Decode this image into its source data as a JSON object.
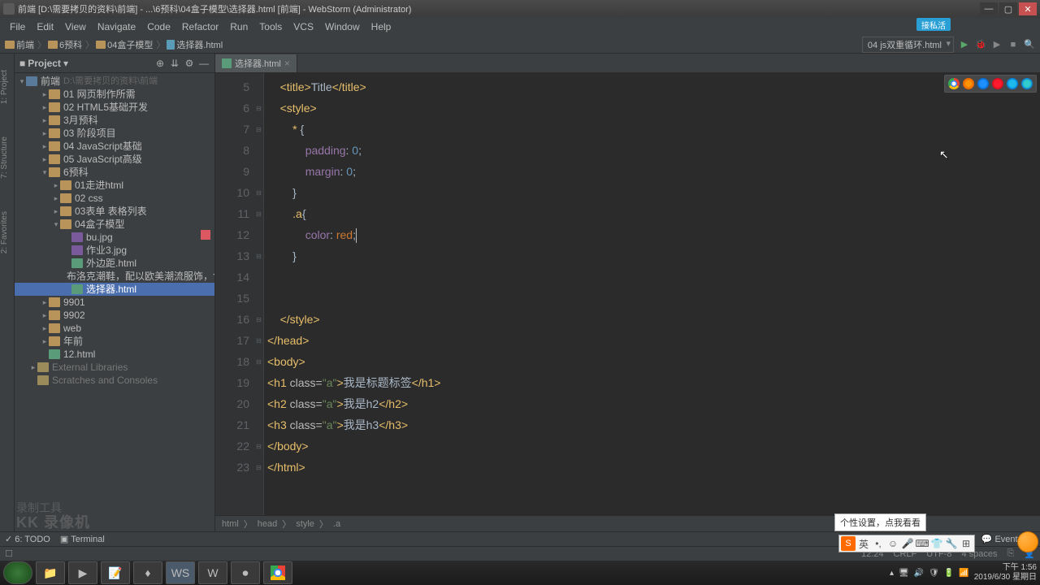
{
  "title": "前端 [D:\\需要拷贝的资料\\前端] - ...\\6预科\\04盒子模型\\选择器.html [前端] - WebStorm (Administrator)",
  "menu": [
    "File",
    "Edit",
    "View",
    "Navigate",
    "Code",
    "Refactor",
    "Run",
    "Tools",
    "VCS",
    "Window",
    "Help"
  ],
  "cloud_label": "接私活",
  "nav": {
    "crumbs": [
      "前端",
      "6预科",
      "04盒子模型",
      "选择器.html"
    ],
    "run_config": "04 js双重循环.html"
  },
  "project": {
    "title": "Project",
    "root": {
      "label": "前端",
      "path": "D:\\需要拷贝的资料\\前端"
    },
    "items": [
      {
        "label": "01 网页制作所需",
        "indent": 2,
        "arrow": "▸",
        "ico": "ico-folder"
      },
      {
        "label": "02 HTML5基础开发",
        "indent": 2,
        "arrow": "▸",
        "ico": "ico-folder"
      },
      {
        "label": "3月预科",
        "indent": 2,
        "arrow": "▸",
        "ico": "ico-folder"
      },
      {
        "label": "03 阶段项目",
        "indent": 2,
        "arrow": "▸",
        "ico": "ico-folder"
      },
      {
        "label": "04 JavaScript基础",
        "indent": 2,
        "arrow": "▸",
        "ico": "ico-folder"
      },
      {
        "label": "05 JavaScript高级",
        "indent": 2,
        "arrow": "▸",
        "ico": "ico-folder"
      },
      {
        "label": "6预科",
        "indent": 2,
        "arrow": "▾",
        "ico": "ico-folder"
      },
      {
        "label": "01走进html",
        "indent": 3,
        "arrow": "▸",
        "ico": "ico-folder"
      },
      {
        "label": "02 css",
        "indent": 3,
        "arrow": "▸",
        "ico": "ico-folder"
      },
      {
        "label": "03表单 表格列表",
        "indent": 3,
        "arrow": "▸",
        "ico": "ico-folder"
      },
      {
        "label": "04盒子模型",
        "indent": 3,
        "arrow": "▾",
        "ico": "ico-folder"
      },
      {
        "label": "bu.jpg",
        "indent": 4,
        "arrow": "",
        "ico": "ico-img"
      },
      {
        "label": "作业3.jpg",
        "indent": 4,
        "arrow": "",
        "ico": "ico-img"
      },
      {
        "label": "外边距.html",
        "indent": 4,
        "arrow": "",
        "ico": "ico-html"
      },
      {
        "label": "布洛克潮鞋，配以欧美潮流服饰，色彩",
        "indent": 4,
        "arrow": "",
        "ico": "ico-html"
      },
      {
        "label": "选择器.html",
        "indent": 4,
        "arrow": "",
        "ico": "ico-html",
        "selected": true
      },
      {
        "label": "9901",
        "indent": 2,
        "arrow": "▸",
        "ico": "ico-folder"
      },
      {
        "label": "9902",
        "indent": 2,
        "arrow": "▸",
        "ico": "ico-folder"
      },
      {
        "label": "web",
        "indent": 2,
        "arrow": "▸",
        "ico": "ico-folder"
      },
      {
        "label": "年前",
        "indent": 2,
        "arrow": "▸",
        "ico": "ico-folder"
      },
      {
        "label": "12.html",
        "indent": 2,
        "arrow": "",
        "ico": "ico-html"
      },
      {
        "label": "External Libraries",
        "indent": 1,
        "arrow": "▸",
        "ico": "ico-lib",
        "muted": true
      },
      {
        "label": "Scratches and Consoles",
        "indent": 1,
        "arrow": "",
        "ico": "ico-lib",
        "muted": true
      }
    ]
  },
  "tab": {
    "label": "选择器.html"
  },
  "code_lines_start": 5,
  "breadcrumb": [
    "html",
    "head",
    "style",
    ".a"
  ],
  "tool_windows": {
    "todo": "6: TODO",
    "terminal": "Terminal",
    "event_log": "Event Log"
  },
  "status": {
    "pos": "12:24",
    "le": "CRLF",
    "enc": "UTF-8",
    "indent": "4 spaces"
  },
  "ime_tip": "个性设置，点我看看",
  "ime_lang": "英",
  "watermark": {
    "l1": "录制工具",
    "l2": "KK 录像机"
  },
  "clock": {
    "time": "下午 1:56",
    "date": "2019/6/30 星期日"
  }
}
